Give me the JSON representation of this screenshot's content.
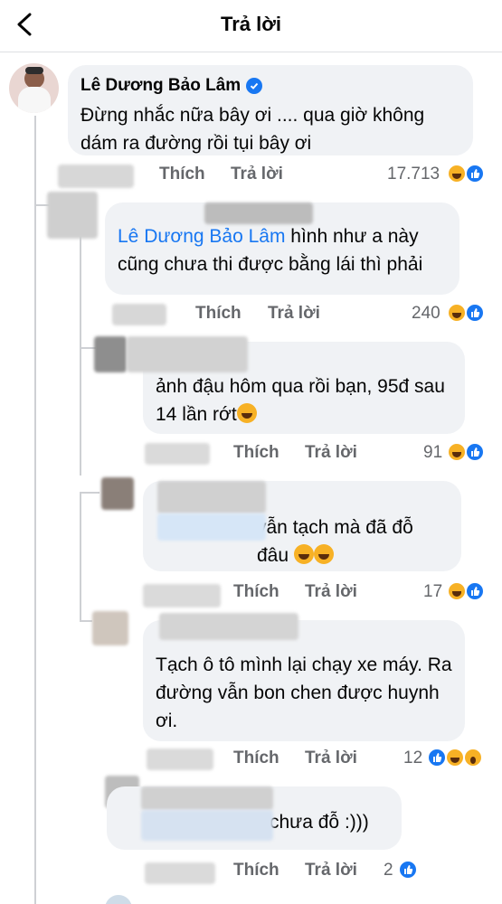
{
  "header": {
    "title": "Trả lời",
    "back_icon": "chevron-left-icon"
  },
  "actions": {
    "like": "Thích",
    "reply": "Trả lời"
  },
  "colors": {
    "accent": "#1877f2",
    "bubble": "#f0f2f5",
    "meta": "#65676b",
    "haha": "#f7b125"
  },
  "comments": [
    {
      "name": "Lê Dương Bảo Lâm",
      "verified": true,
      "text": "Đừng nhắc nữa bây ơi .... qua giờ không dám ra đường rồi tụi bây ơi",
      "count": "17.713",
      "reactions": [
        "haha",
        "like"
      ]
    },
    {
      "mention": "Lê Dương Bảo Lâm",
      "text": " hình như a này cũng chưa thi được bằng lái thì phải",
      "count": "240",
      "reactions": [
        "haha",
        "like"
      ]
    },
    {
      "text": " ảnh đậu hôm qua rồi bạn, 95đ sau 14 lần rớt",
      "count": "91",
      "reactions": [
        "haha",
        "like"
      ]
    },
    {
      "text": "vẫn tạch mà đã đỗ đâu",
      "count": "17",
      "reactions": [
        "haha",
        "like"
      ]
    },
    {
      "text": "Tạch ô tô mình lại chạy xe máy. Ra đường vẫn bon chen được huynh ơi.",
      "count": "12",
      "reactions": [
        "like",
        "haha",
        "wow"
      ]
    },
    {
      "text": "chưa đỗ :)))",
      "count": "2",
      "reactions": [
        "like"
      ]
    }
  ]
}
